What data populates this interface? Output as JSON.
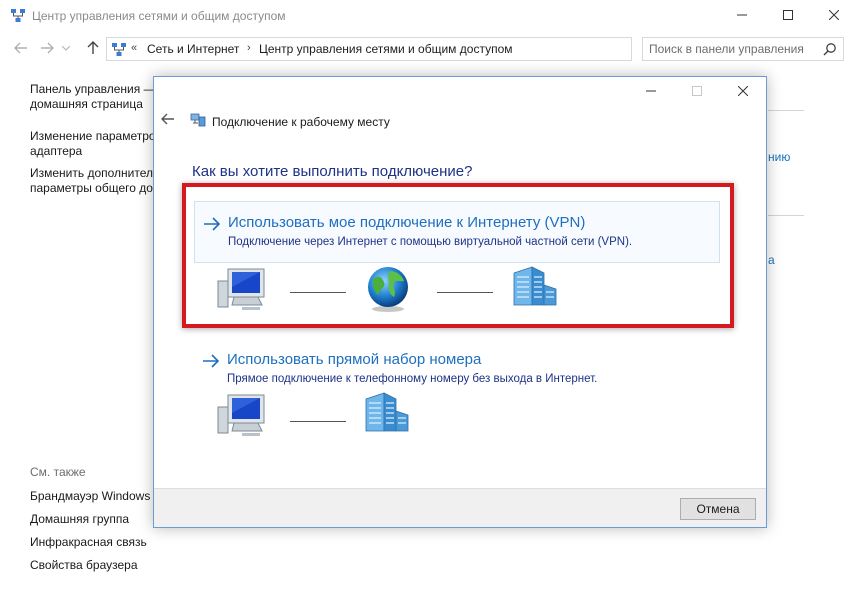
{
  "window": {
    "title": "Центр управления сетями и общим доступом"
  },
  "address_bar": {
    "chevron": "«",
    "crumbs": [
      "Сеть и Интернет",
      "Центр управления сетями и общим доступом"
    ],
    "separator": "›"
  },
  "search": {
    "placeholder": "Поиск в панели управления"
  },
  "left_panel": {
    "links": [
      {
        "line1": "Панель управления —",
        "line2": "домашняя страница"
      },
      {
        "line1": "Изменение параметров",
        "line2": "адаптера"
      },
      {
        "line1": "Изменить дополнительные",
        "line2": "параметры общего доступа"
      }
    ],
    "see_also_label": "См. также",
    "see_also": [
      "Брандмауэр Windows",
      "Домашняя группа",
      "Инфракрасная связь",
      "Свойства браузера"
    ]
  },
  "background_fragments": [
    "нию",
    "а"
  ],
  "dialog": {
    "title": "Подключение к рабочему месту",
    "question": "Как вы хотите выполнить подключение?",
    "options": [
      {
        "title": "Использовать мое подключение к Интернету (VPN)",
        "description": "Подключение через Интернет с помощью виртуальной частной сети (VPN)."
      },
      {
        "title": "Использовать прямой набор номера",
        "description": "Прямое подключение к телефонному номеру без выхода в Интернет."
      }
    ],
    "cancel_label": "Отмена"
  },
  "colors": {
    "link_blue": "#1e6fbf",
    "heading_blue": "#1e3287",
    "highlight_red": "#d41a1f"
  },
  "icons": [
    "network-center-icon",
    "minimize-icon",
    "maximize-icon",
    "close-icon",
    "back-arrow-icon",
    "forward-arrow-icon",
    "up-arrow-icon",
    "refresh-icon",
    "search-icon",
    "connection-wizard-icon",
    "computer-icon",
    "globe-icon",
    "workplace-building-icon",
    "option-arrow-icon"
  ]
}
